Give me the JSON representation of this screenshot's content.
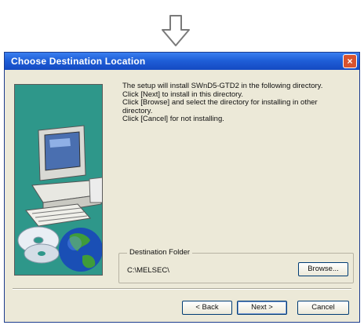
{
  "dialog": {
    "title": "Choose Destination Location",
    "close_label": "×"
  },
  "instructions": {
    "line1": "The setup will install SWnD5-GTD2 in the following directory.",
    "line2": "Click [Next] to install in this directory.",
    "line3": "Click [Browse] and select the directory for installing in other\ndirectory.",
    "line4": "Click [Cancel] for not installing."
  },
  "destination": {
    "legend": "Destination Folder",
    "path": "C:\\MELSEC\\",
    "browse_label": "Browse..."
  },
  "buttons": {
    "back": "< Back",
    "next": "Next >",
    "cancel": "Cancel"
  },
  "colors": {
    "titlebar": "#1f5fd8",
    "panel_teal": "#2e978a",
    "dialog_bg": "#ece9d8"
  },
  "icons": [
    "down-arrow-icon",
    "computer-icon",
    "cd-discs-icon",
    "globe-icon",
    "close-icon"
  ]
}
